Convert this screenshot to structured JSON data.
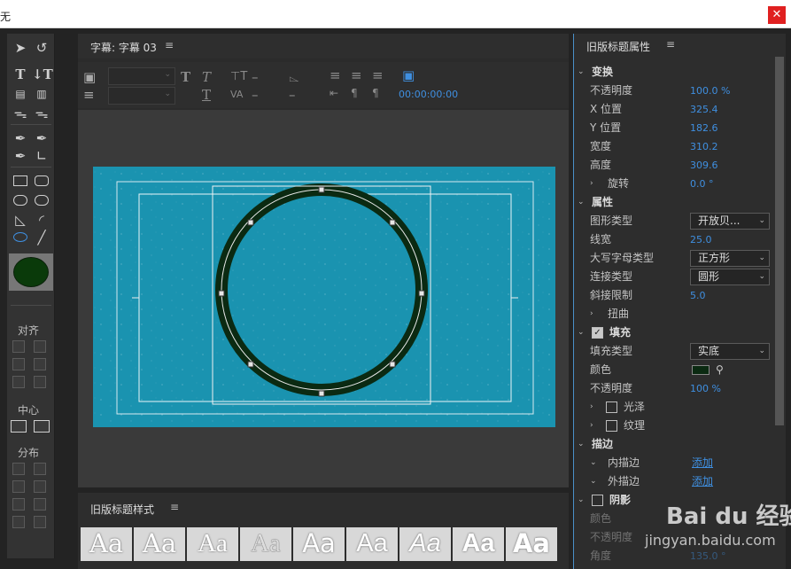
{
  "window": {
    "app_fragment": "无"
  },
  "editor": {
    "tab_title": "字幕: 字幕 03",
    "timecode": "00:00:00:00"
  },
  "tools": {
    "align_label": "对齐",
    "center_label": "中心",
    "distribute_label": "分布"
  },
  "styles_panel": {
    "title": "旧版标题样式",
    "swatches": [
      "Aa",
      "Aa",
      "Aa",
      "Aa",
      "Aa",
      "Aa",
      "Aa",
      "Aa",
      "Aa"
    ]
  },
  "properties": {
    "title": "旧版标题属性",
    "transform": {
      "title": "变换",
      "opacity_label": "不透明度",
      "opacity": "100.0 %",
      "x_label": "X 位置",
      "x": "325.4",
      "y_label": "Y 位置",
      "y": "182.6",
      "width_label": "宽度",
      "width": "310.2",
      "height_label": "高度",
      "height": "309.6",
      "rotation_label": "旋转",
      "rotation": "0.0 °"
    },
    "attributes": {
      "title": "属性",
      "graphic_type_label": "图形类型",
      "graphic_type": "开放贝...",
      "line_width_label": "线宽",
      "line_width": "25.0",
      "cap_type_label": "大写字母类型",
      "cap_type": "正方形",
      "join_type_label": "连接类型",
      "join_type": "圆形",
      "miter_label": "斜接限制",
      "miter": "5.0",
      "distort_label": "扭曲"
    },
    "fill": {
      "title": "填充",
      "fill_type_label": "填充类型",
      "fill_type": "实底",
      "color_label": "颜色",
      "color": "#0b2a12",
      "opacity_label": "不透明度",
      "opacity": "100 %",
      "sheen_label": "光泽",
      "texture_label": "纹理"
    },
    "stroke": {
      "title": "描边",
      "inner_label": "内描边",
      "outer_label": "外描边",
      "add_label": "添加"
    },
    "shadow": {
      "title": "阴影",
      "color_label": "颜色",
      "opacity_label": "不透明度",
      "angle_label": "角度",
      "angle": "135.0 °"
    }
  },
  "colors": {
    "accent": "#3f8fe0",
    "canvas_bg": "#1a93b0",
    "ring": "#0b2a12"
  },
  "watermark": {
    "brand": "Bai du 经验",
    "url": "jingyan.baidu.com"
  }
}
